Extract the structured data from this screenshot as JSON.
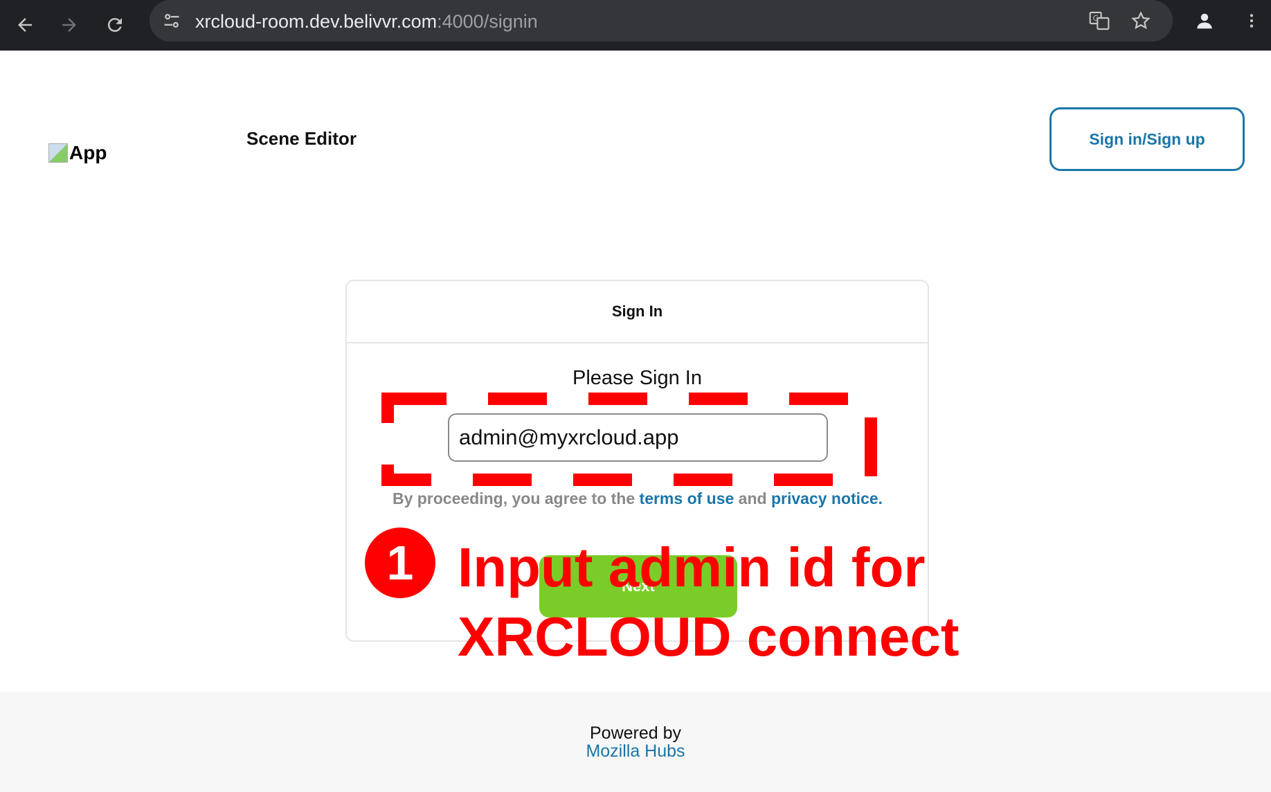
{
  "browser": {
    "url_host": "xrcloud-room.dev.belivvr.com",
    "url_path": ":4000/signin"
  },
  "header": {
    "logo_alt": "App",
    "title": "Scene Editor",
    "signin_button": "Sign in/Sign up"
  },
  "card": {
    "title": "Sign In",
    "prompt": "Please Sign In",
    "email_value": "admin@myxrcloud.app",
    "terms_prefix": "By proceeding, you agree to the ",
    "terms_link": "terms of use",
    "terms_mid": " and ",
    "privacy_link": "privacy notice",
    "terms_suffix": ".",
    "next_button": "Next"
  },
  "footer": {
    "powered_by": "Powered by",
    "provider": "Mozilla Hubs"
  },
  "annotation": {
    "step": "1",
    "line1": "Input admin id for",
    "line2": "XRCLOUD connect",
    "color": "#ff0000"
  }
}
